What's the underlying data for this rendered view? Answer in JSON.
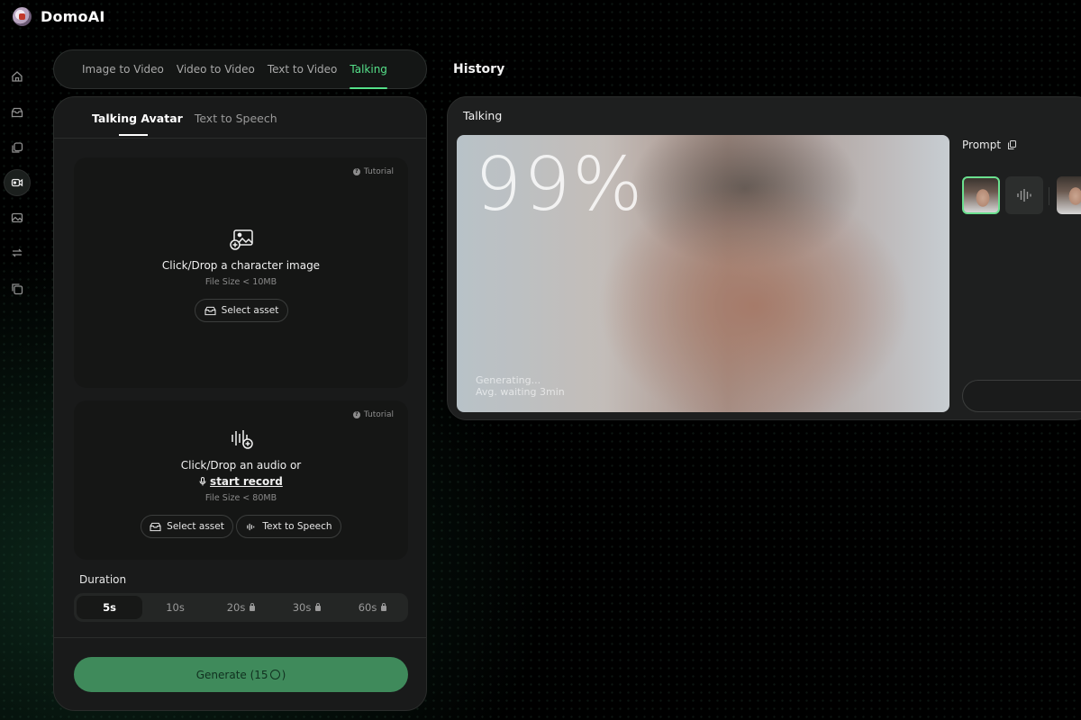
{
  "app": {
    "name": "DomoAI"
  },
  "nav": {
    "rail": [
      "home-icon",
      "assets-icon",
      "gallery-icon",
      "video-icon",
      "image-icon",
      "convert-icon",
      "stack-icon"
    ],
    "active_rail": "video-icon"
  },
  "mode_tabs": [
    {
      "label": "Image to Video",
      "active": false
    },
    {
      "label": "Video to Video",
      "active": false
    },
    {
      "label": "Text to Video",
      "active": false
    },
    {
      "label": "Talking",
      "active": true
    }
  ],
  "sub_tabs": [
    {
      "label": "Talking Avatar",
      "active": true
    },
    {
      "label": "Text to Speech",
      "active": false
    }
  ],
  "image_drop": {
    "tutorial": "Tutorial",
    "title": "Click/Drop a character image",
    "file_size": "File Size < 10MB",
    "select_asset": "Select asset"
  },
  "audio_drop": {
    "tutorial": "Tutorial",
    "title": "Click/Drop an audio or",
    "record": "start record",
    "file_size": "File Size < 80MB",
    "select_asset": "Select asset",
    "text_to_speech": "Text to Speech"
  },
  "duration": {
    "label": "Duration",
    "options": [
      {
        "label": "5s",
        "locked": false,
        "active": true
      },
      {
        "label": "10s",
        "locked": false,
        "active": false
      },
      {
        "label": "20s",
        "locked": true,
        "active": false
      },
      {
        "label": "30s",
        "locked": true,
        "active": false
      },
      {
        "label": "60s",
        "locked": true,
        "active": false
      }
    ]
  },
  "generate": {
    "label": "Generate (15",
    "label_end": ")"
  },
  "history": {
    "title": "History",
    "card_label": "Talking",
    "progress_text": "99%",
    "progress": 0.99,
    "status": "Generating...",
    "wait": "Avg. waiting 3min",
    "prompt_label": "Prompt"
  },
  "colors": {
    "accent": "#55e089",
    "generate_bg": "#3f8a5b",
    "panel_bg": "#191a1a"
  }
}
